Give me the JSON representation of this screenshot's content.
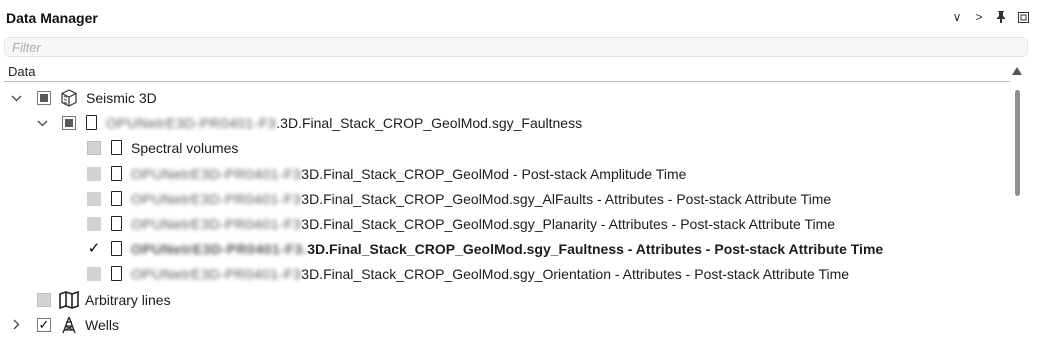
{
  "panel": {
    "title": "Data Manager",
    "tools": [
      "chevron-down",
      "chevron-right",
      "pin",
      "maximize"
    ],
    "tool_glyphs": [
      "∨",
      ">",
      "†",
      "▣"
    ]
  },
  "filter": {
    "placeholder": "Filter",
    "value": ""
  },
  "column_header": "Data",
  "tree": {
    "seismic3d": {
      "label": "Seismic 3D",
      "state": "partial",
      "expanded": true,
      "icon": "cube-icon"
    },
    "volume": {
      "prefix_redacted": "OPUNetrE3D-PR0401-F3",
      "suffix": ".3D.Final_Stack_CROP_GeolMod.sgy_Faultness",
      "state": "partial",
      "expanded": true
    },
    "children": [
      {
        "prefix_redacted": "",
        "label": "Spectral volumes",
        "state": "grey-framed",
        "bold": false
      },
      {
        "prefix_redacted": "OPUNetrE3D-PR0401-F3",
        "label": "3D.Final_Stack_CROP_GeolMod - Post-stack Amplitude Time",
        "state": "grey",
        "bold": false
      },
      {
        "prefix_redacted": "OPUNetrE3D-PR0401-F3",
        "label": "3D.Final_Stack_CROP_GeolMod.sgy_AlFaults - Attributes - Post-stack Attribute Time",
        "state": "grey",
        "bold": false
      },
      {
        "prefix_redacted": "OPUNetrE3D-PR0401-F3",
        "label": "3D.Final_Stack_CROP_GeolMod.sgy_Planarity - Attributes - Post-stack Attribute Time",
        "state": "grey",
        "bold": false
      },
      {
        "prefix_redacted": "OPUNetrE3D-PR0401-F3.",
        "label": "3D.Final_Stack_CROP_GeolMod.sgy_Faultness - Attributes - Post-stack Attribute Time",
        "state": "checked",
        "bold": true
      },
      {
        "prefix_redacted": "OPUNetrE3D-PR0401-F3",
        "label": "3D.Final_Stack_CROP_GeolMod.sgy_Orientation - Attributes - Post-stack Attribute Time",
        "state": "grey",
        "bold": false
      }
    ],
    "arbitrary": {
      "label": "Arbitrary lines",
      "state": "grey-framed",
      "icon": "map-icon"
    },
    "wells": {
      "label": "Wells",
      "state": "checked-framed",
      "expanded": false,
      "icon": "derrick-icon"
    }
  },
  "glyphs": {
    "check": "✓"
  }
}
